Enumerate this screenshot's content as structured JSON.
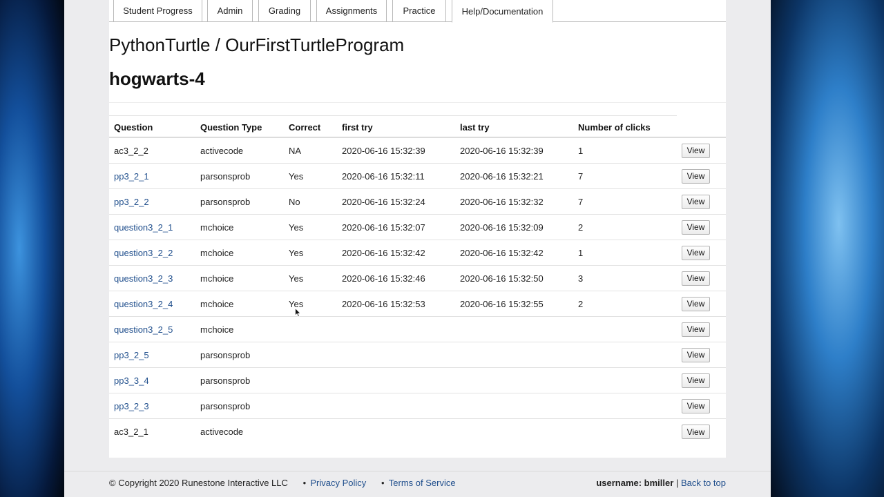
{
  "tabs": [
    {
      "label": "Student Progress"
    },
    {
      "label": "Admin"
    },
    {
      "label": "Grading"
    },
    {
      "label": "Assignments"
    },
    {
      "label": "Practice"
    },
    {
      "label": "Help/Documentation"
    }
  ],
  "page": {
    "title": "PythonTurtle / OurFirstTurtleProgram",
    "subtitle": "hogwarts-4"
  },
  "table": {
    "headers": [
      "Question",
      "Question Type",
      "Correct",
      "first try",
      "last try",
      "Number of clicks"
    ],
    "view_label": "View",
    "rows": [
      {
        "question": "ac3_2_2",
        "type": "activecode",
        "correct": "NA",
        "first": "2020-06-16 15:32:39",
        "last": "2020-06-16 15:32:39",
        "clicks": "1"
      },
      {
        "question": "pp3_2_1",
        "type": "parsonsprob",
        "correct": "Yes",
        "first": "2020-06-16 15:32:11",
        "last": "2020-06-16 15:32:21",
        "clicks": "7"
      },
      {
        "question": "pp3_2_2",
        "type": "parsonsprob",
        "correct": "No",
        "first": "2020-06-16 15:32:24",
        "last": "2020-06-16 15:32:32",
        "clicks": "7"
      },
      {
        "question": "question3_2_1",
        "type": "mchoice",
        "correct": "Yes",
        "first": "2020-06-16 15:32:07",
        "last": "2020-06-16 15:32:09",
        "clicks": "2"
      },
      {
        "question": "question3_2_2",
        "type": "mchoice",
        "correct": "Yes",
        "first": "2020-06-16 15:32:42",
        "last": "2020-06-16 15:32:42",
        "clicks": "1"
      },
      {
        "question": "question3_2_3",
        "type": "mchoice",
        "correct": "Yes",
        "first": "2020-06-16 15:32:46",
        "last": "2020-06-16 15:32:50",
        "clicks": "3"
      },
      {
        "question": "question3_2_4",
        "type": "mchoice",
        "correct": "Yes",
        "first": "2020-06-16 15:32:53",
        "last": "2020-06-16 15:32:55",
        "clicks": "2"
      },
      {
        "question": "question3_2_5",
        "type": "mchoice",
        "correct": "",
        "first": "",
        "last": "",
        "clicks": ""
      },
      {
        "question": "pp3_2_5",
        "type": "parsonsprob",
        "correct": "",
        "first": "",
        "last": "",
        "clicks": ""
      },
      {
        "question": "pp3_3_4",
        "type": "parsonsprob",
        "correct": "",
        "first": "",
        "last": "",
        "clicks": ""
      },
      {
        "question": "pp3_2_3",
        "type": "parsonsprob",
        "correct": "",
        "first": "",
        "last": "",
        "clicks": ""
      },
      {
        "question": "ac3_2_1",
        "type": "activecode",
        "correct": "",
        "first": "",
        "last": "",
        "clicks": ""
      }
    ]
  },
  "footer": {
    "copyright": "© Copyright 2020 Runestone Interactive LLC",
    "bullet": "●",
    "privacy": "Privacy Policy",
    "terms": "Terms of Service",
    "username_label": "username: bmiller",
    "divider": "|",
    "back_to_top": "Back to top"
  },
  "colors": {
    "link": "#1f4e8c"
  }
}
